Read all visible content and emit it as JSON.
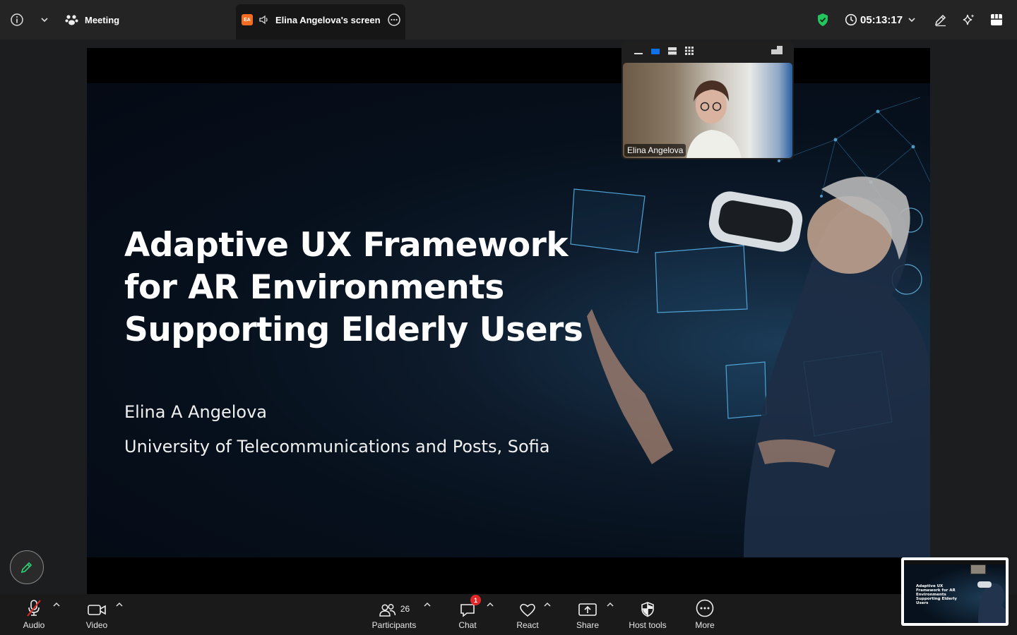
{
  "colors": {
    "topbar": "#242424",
    "bottombar": "#1a1a1a",
    "accent_blue": "#0e71eb",
    "shield_green": "#22c55e",
    "badge_red": "#e02828",
    "presenter_badge": "#f26d21"
  },
  "topbar": {
    "meeting_label": "Meeting",
    "shared_tab": {
      "badge": "EA",
      "title": "Elina Angelova's screen"
    },
    "timer": "05:13:17",
    "icons": [
      "info-icon",
      "chevron-down-icon",
      "participants-paw-icon",
      "speaker-icon",
      "more-options-icon",
      "security-shield-icon",
      "clock-icon",
      "annotate-pen-icon",
      "ai-sparkle-icon",
      "apps-grid-icon"
    ]
  },
  "slide": {
    "title_lines": [
      "Adaptive UX Framework",
      "for AR Environments",
      "Supporting Elderly Users"
    ],
    "author": "Elina A Angelova",
    "affiliation": "University of Telecommunications and Posts, Sofia"
  },
  "video_panel": {
    "layout_options": [
      "minimize",
      "single-speaker",
      "side-by-side",
      "gallery"
    ],
    "participant_name": "Elina Angelova"
  },
  "bottombar": {
    "audio_label": "Audio",
    "video_label": "Video",
    "participants_label": "Participants",
    "participants_count": "26",
    "chat_label": "Chat",
    "chat_unread": "1",
    "react_label": "React",
    "share_label": "Share",
    "host_tools_label": "Host tools",
    "more_label": "More"
  },
  "thumbnail": {
    "title": "Adaptive UX Framework for AR Environments Supporting Elderly Users"
  }
}
